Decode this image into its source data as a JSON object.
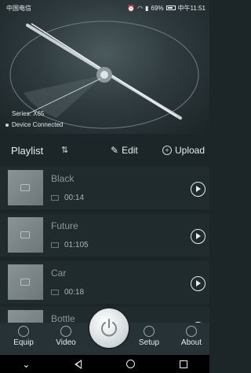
{
  "status_bar": {
    "carrier": "中国电信",
    "battery_percent": "69%",
    "time": "中午11:51"
  },
  "device": {
    "series": "Series: X65",
    "connection": "Device Connected"
  },
  "playlist": {
    "title": "Playlist",
    "edit_label": "Edit",
    "upload_label": "Upload",
    "items": [
      {
        "title": "Black",
        "duration": "00:14"
      },
      {
        "title": "Future",
        "duration": "01:105"
      },
      {
        "title": "Car",
        "duration": "00:18"
      },
      {
        "title": "Bottle",
        "duration": ""
      }
    ]
  },
  "bottom_nav": {
    "equip": "Equip",
    "video": "Video",
    "setup": "Setup",
    "about": "About"
  }
}
